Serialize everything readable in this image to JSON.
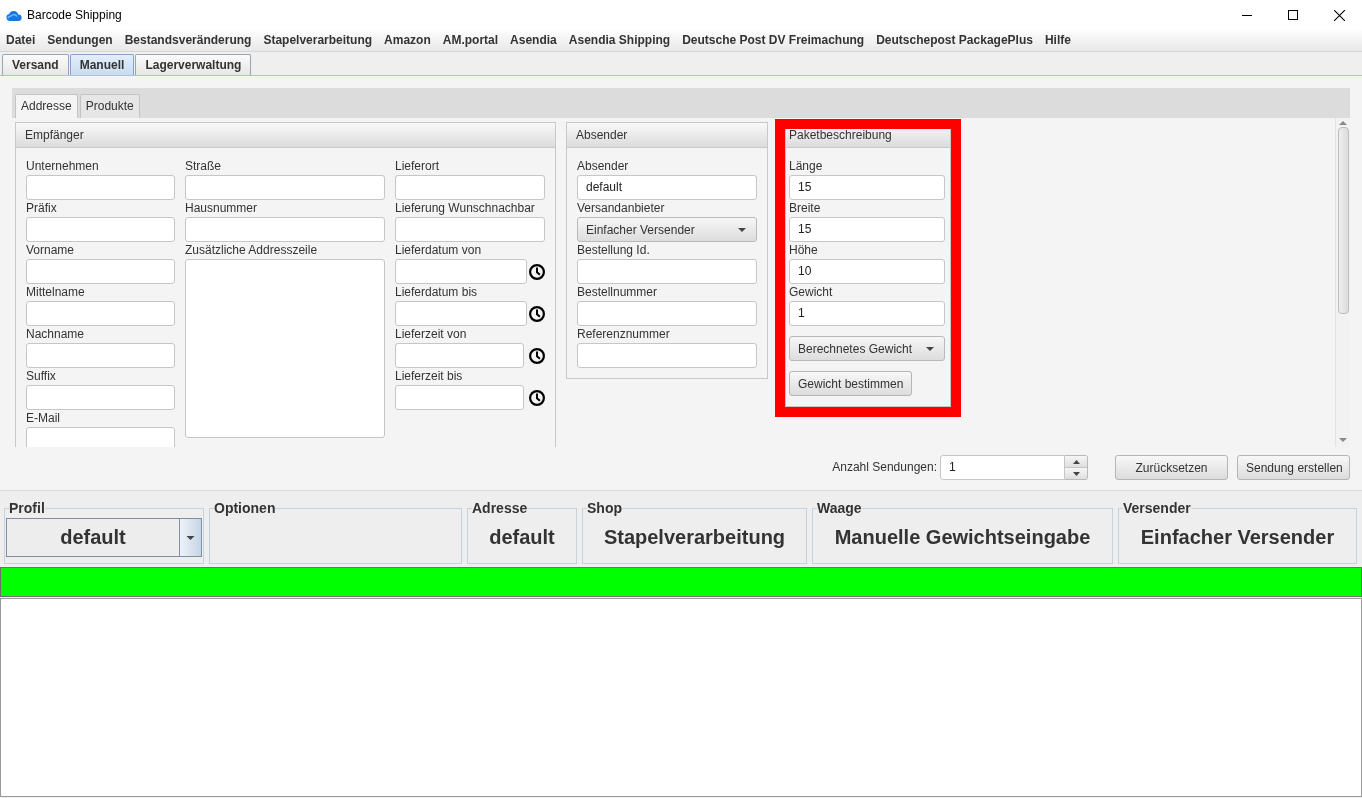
{
  "window": {
    "title": "Barcode Shipping"
  },
  "menu": [
    "Datei",
    "Sendungen",
    "Bestandsveränderung",
    "Stapelverarbeitung",
    "Amazon",
    "AM.portal",
    "Asendia",
    "Asendia Shipping",
    "Deutsche Post DV Freimachung",
    "Deutschepost PackagePlus",
    "Hilfe"
  ],
  "main_tabs": [
    {
      "label": "Versand",
      "selected": false
    },
    {
      "label": "Manuell",
      "selected": true
    },
    {
      "label": "Lagerverwaltung",
      "selected": false
    }
  ],
  "sub_tabs": [
    {
      "label": "Addresse",
      "selected": true
    },
    {
      "label": "Produkte",
      "selected": false
    }
  ],
  "recipient": {
    "title": "Empfänger",
    "columns": [
      [
        {
          "label": "Unternehmen",
          "kind": "text"
        },
        {
          "label": "Präfix",
          "kind": "text"
        },
        {
          "label": "Vorname",
          "kind": "text"
        },
        {
          "label": "Mittelname",
          "kind": "text"
        },
        {
          "label": "Nachname",
          "kind": "text"
        },
        {
          "label": "Suffix",
          "kind": "text"
        },
        {
          "label": "E-Mail",
          "kind": "text"
        }
      ],
      [
        {
          "label": "Straße",
          "kind": "text"
        },
        {
          "label": "Hausnummer",
          "kind": "text"
        },
        {
          "label": "Zusätzliche Addresszeile",
          "kind": "textarea"
        }
      ],
      [
        {
          "label": "Lieferort",
          "kind": "text"
        },
        {
          "label": "Lieferung Wunschnachbar",
          "kind": "text"
        },
        {
          "label": "Lieferdatum von",
          "kind": "date"
        },
        {
          "label": "Lieferdatum bis",
          "kind": "date"
        },
        {
          "label": "Lieferzeit von",
          "kind": "time"
        },
        {
          "label": "Lieferzeit bis",
          "kind": "time"
        }
      ]
    ]
  },
  "sender": {
    "title": "Absender",
    "fields": [
      {
        "label": "Absender",
        "kind": "text",
        "value": "default"
      },
      {
        "label": "Versandanbieter",
        "kind": "select",
        "value": "Einfacher Versender"
      },
      {
        "label": "Bestellung Id.",
        "kind": "text"
      },
      {
        "label": "Bestellnummer",
        "kind": "text"
      },
      {
        "label": "Referenznummer",
        "kind": "text"
      }
    ]
  },
  "package": {
    "title": "Paketbeschreibung",
    "highlighted": true,
    "fields": [
      {
        "label": "Länge",
        "kind": "text",
        "value": "15"
      },
      {
        "label": "Breite",
        "kind": "text",
        "value": "15"
      },
      {
        "label": "Höhe",
        "kind": "text",
        "value": "10"
      },
      {
        "label": "Gewicht",
        "kind": "text",
        "value": "1"
      },
      {
        "kind": "select",
        "value": "Berechnetes Gewicht"
      },
      {
        "kind": "button",
        "text": "Gewicht bestimmen"
      }
    ]
  },
  "quantity": {
    "label": "Anzahl Sendungen:",
    "value": "1"
  },
  "actions": [
    "Zurücksetzen",
    "Sendung erstellen"
  ],
  "info_groups": [
    {
      "title": "Profil",
      "kind": "dropdown",
      "value": "default"
    },
    {
      "title": "Optionen",
      "kind": "empty"
    },
    {
      "title": "Adresse",
      "kind": "text",
      "value": "default"
    },
    {
      "title": "Shop",
      "kind": "text",
      "value": "Stapelverarbeitung"
    },
    {
      "title": "Waage",
      "kind": "text",
      "value": "Manuelle Gewichtseingabe"
    },
    {
      "title": "Versender",
      "kind": "text",
      "value": "Einfacher Versender"
    }
  ],
  "status_light": {
    "success": true
  }
}
